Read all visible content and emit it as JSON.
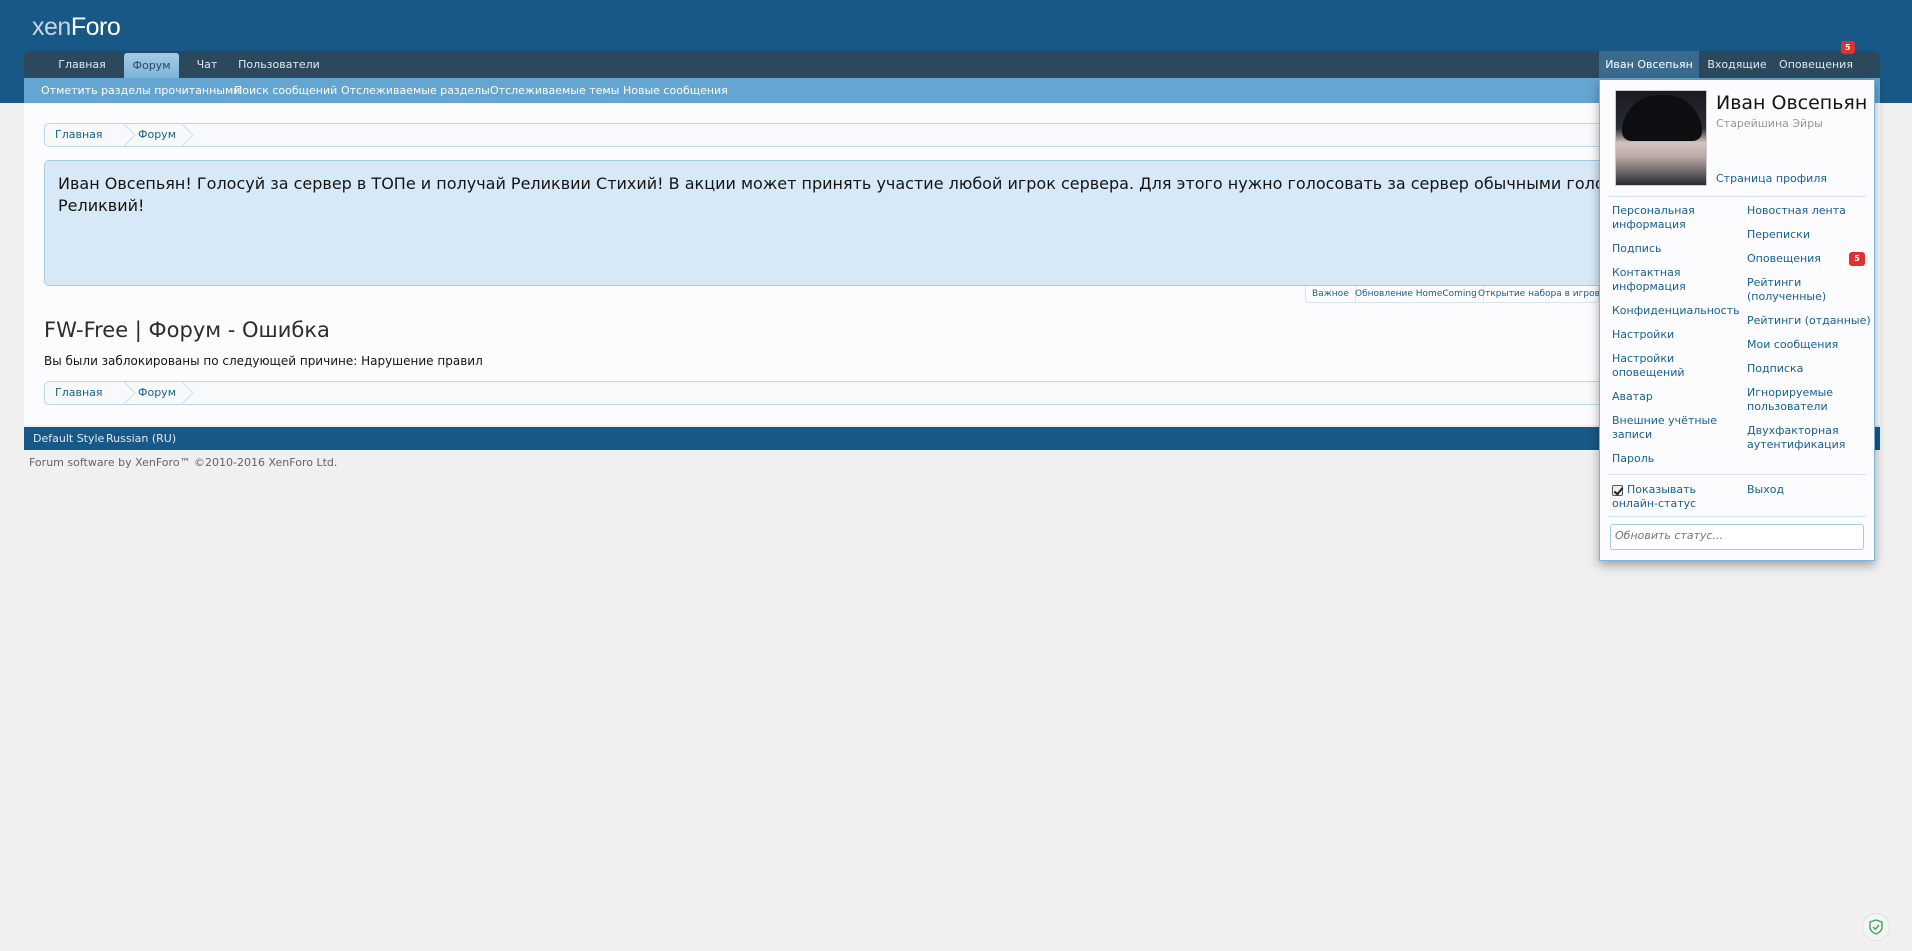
{
  "logo": {
    "part1": "xen",
    "part2": "Foro"
  },
  "nav": {
    "tabs": [
      "Главная",
      "Форум",
      "Чат",
      "Пользователи"
    ],
    "active_tab": "Форум",
    "user_name": "Иван Овсепьян",
    "inbox": "Входящие",
    "alerts": "Оповещения",
    "alerts_count": "5"
  },
  "subnav": [
    "Отметить разделы прочитанными",
    "Поиск сообщений",
    "Отслеживаемые разделы",
    "Отслеживаемые темы",
    "Новые сообщения"
  ],
  "breadcrumb": [
    "Главная",
    "Форум"
  ],
  "notice": {
    "text": "Иван Овсепьян! Голосуй за сервер в ТОПе и получай Реликвии Стихий! В акции может принять участие любой игрок сервера. Для этого нужно голосовать за сервер обычными голосами. 1 о",
    "text2": "Реликвий!"
  },
  "notice_tabs": [
    "Важное",
    "Обновление HomeComing",
    "Открытие набора в игровые"
  ],
  "page": {
    "title": "FW-Free | Форум - Ошибка",
    "error": "Вы были заблокированы по следующей причине: Нарушение правил"
  },
  "footer": {
    "style": "Default Style",
    "language": "Russian (RU)",
    "copyright": "Forum software by XenForo™ ©2010-2016 XenForo Ltd."
  },
  "popup": {
    "name": "Иван Овсепьян",
    "user_title": "Старейшина Эйры",
    "profile_link": "Страница профиля",
    "left": [
      [
        "Персональная",
        "информация"
      ],
      [
        "Подпись"
      ],
      [
        "Контактная",
        "информация"
      ],
      [
        "Конфиденциальность"
      ],
      [
        "Настройки"
      ],
      [
        "Настройки",
        "оповещений"
      ],
      [
        "Аватар"
      ],
      [
        "Внешние учётные",
        "записи"
      ],
      [
        "Пароль"
      ]
    ],
    "right": [
      [
        "Новостная лента"
      ],
      [
        "Переписки"
      ],
      [
        "Оповещения"
      ],
      [
        "Рейтинги",
        "(полученные)"
      ],
      [
        "Рейтинги (отданные)"
      ],
      [
        "Мои сообщения"
      ],
      [
        "Подписка"
      ],
      [
        "Игнорируемые",
        "пользователи"
      ],
      [
        "Двухфакторная",
        "аутентификация"
      ]
    ],
    "alerts_count": "5",
    "online_status_1": "Показывать",
    "online_status_2": "онлайн-статус",
    "logout": "Выход",
    "status_placeholder": "Обновить статус..."
  },
  "colors": {
    "header": "#185886",
    "navbar": "#2b485c",
    "subnav": "#65a5d1",
    "notice_bg": "#d7e9f7",
    "link": "#176093",
    "badge": "#e03030"
  }
}
